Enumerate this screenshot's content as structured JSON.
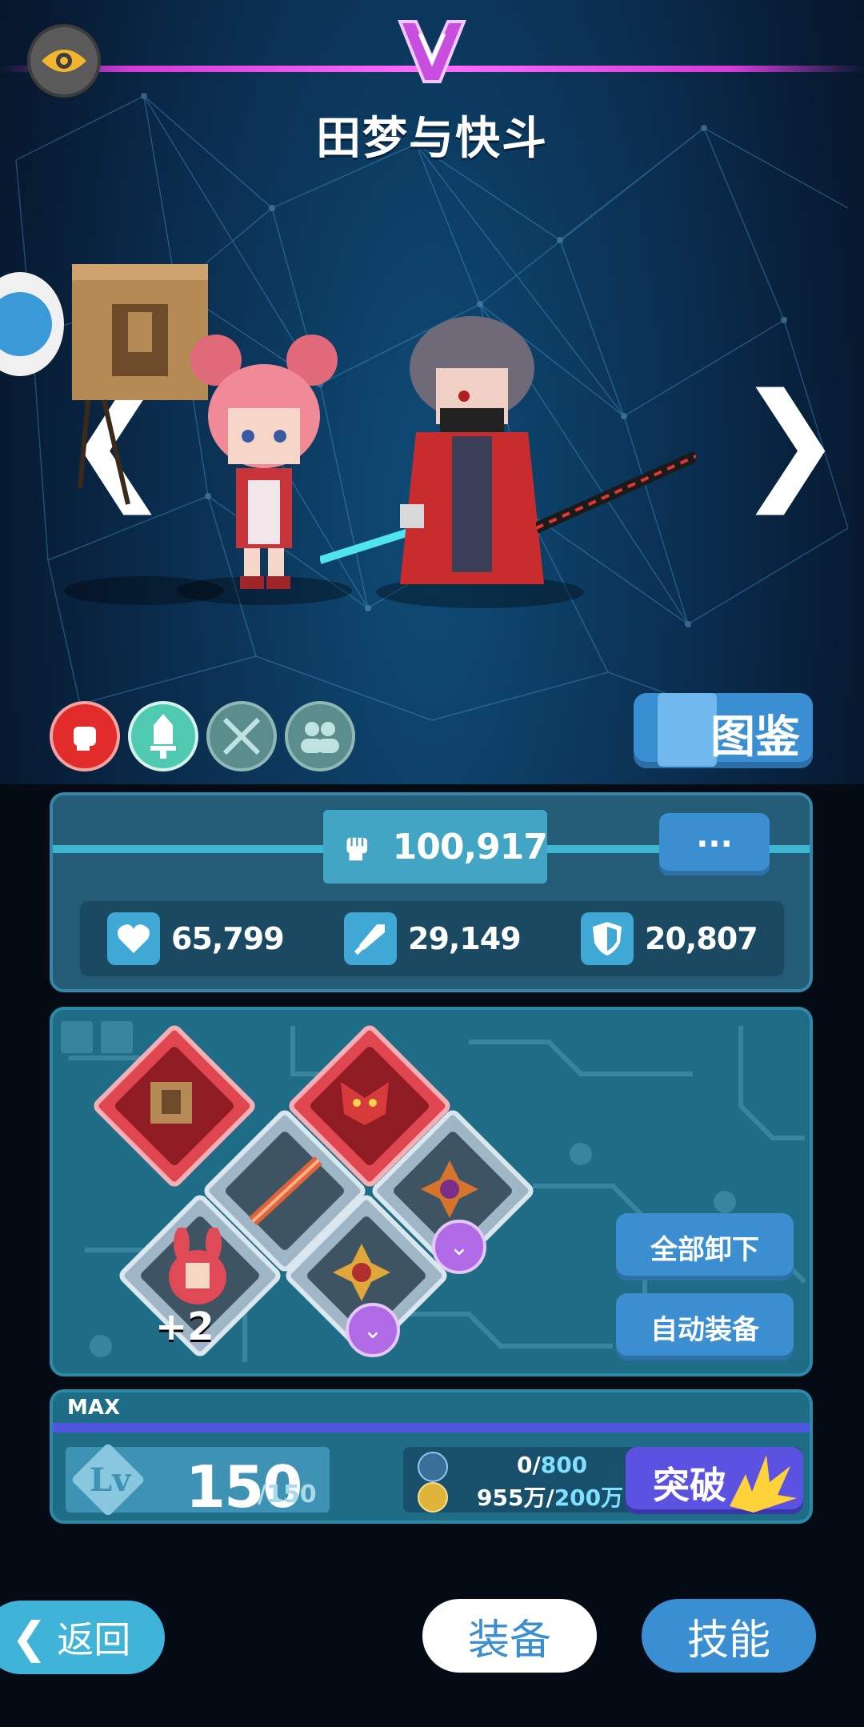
{
  "header": {
    "title": "田梦与快斗",
    "emblem_icon": "v-emblem-icon",
    "view_icon": "eye-icon"
  },
  "navigation": {
    "prev_arrow": "❮",
    "next_arrow": "❯"
  },
  "category_icons": [
    "fist-icon",
    "sword-icon",
    "crossed-swords-icon",
    "group-icon"
  ],
  "codex_button": {
    "label": "图鉴",
    "icon": "book-icon"
  },
  "stats": {
    "power": "100,917",
    "more_label": "···",
    "hp": "65,799",
    "attack": "29,149",
    "defense": "20,807"
  },
  "equipment": {
    "slots": [
      {
        "name": "trophy-item",
        "type": "red"
      },
      {
        "name": "demon-mask-item",
        "type": "red"
      },
      {
        "name": "blade-item",
        "type": "silver"
      },
      {
        "name": "gem-emblem-item",
        "type": "silver",
        "upgradable": true
      },
      {
        "name": "bunny-pet-item",
        "type": "silver",
        "bonus": "+2"
      },
      {
        "name": "crest-item",
        "type": "silver",
        "upgradable": true
      }
    ],
    "unequip_all": "全部卸下",
    "auto_equip": "自动装备"
  },
  "level": {
    "max_label": "MAX",
    "lv_label": "Lv",
    "value": "150",
    "max_value": "/150",
    "resource1_current": "0/",
    "resource1_max": "800",
    "resource2_current": "955万/",
    "resource2_max": "200万",
    "breakthrough": "突破"
  },
  "bottom_nav": {
    "back": "返回",
    "equip": "装备",
    "skill": "技能"
  },
  "colors": {
    "accent": "#3a8fd2",
    "magenta": "#d33ad8",
    "purple": "#5b52e2",
    "red": "#e22b2b",
    "teal": "#4fcab0"
  }
}
